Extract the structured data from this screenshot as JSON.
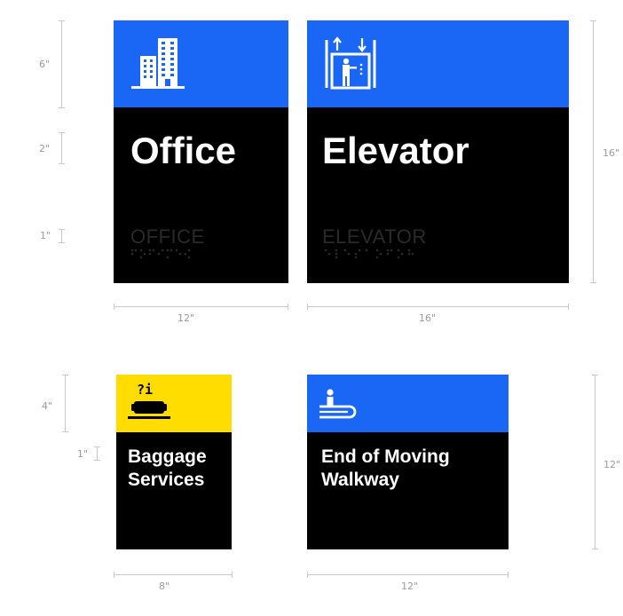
{
  "colors": {
    "blue": "#1a66f5",
    "yellow": "#ffdd00",
    "black": "#000000",
    "white": "#ffffff",
    "dimension_gray": "#9a9a9a"
  },
  "signs": {
    "office": {
      "title": "Office",
      "tactile": "OFFICE",
      "band_color": "blue",
      "icon": "office-building-icon"
    },
    "elevator": {
      "title": "Elevator",
      "tactile": "ELEVATOR",
      "band_color": "blue",
      "icon": "elevator-icon"
    },
    "baggage": {
      "title_line1": "Baggage",
      "title_line2": "Services",
      "band_color": "yellow",
      "icon": "baggage-info-icon",
      "icon_text": "?i"
    },
    "walkway": {
      "title_line1": "End of Moving",
      "title_line2": "Walkway",
      "band_color": "blue",
      "icon": "moving-walkway-icon"
    }
  },
  "dimensions": {
    "office_band_height": "6\"",
    "office_text_height": "2\"",
    "office_tactile_height": "1\"",
    "office_width": "12\"",
    "elevator_width": "16\"",
    "elevator_height": "16\"",
    "baggage_band_height": "4\"",
    "baggage_text_height": "1\"",
    "baggage_width": "8\"",
    "walkway_width": "12\"",
    "walkway_height": "12\""
  }
}
